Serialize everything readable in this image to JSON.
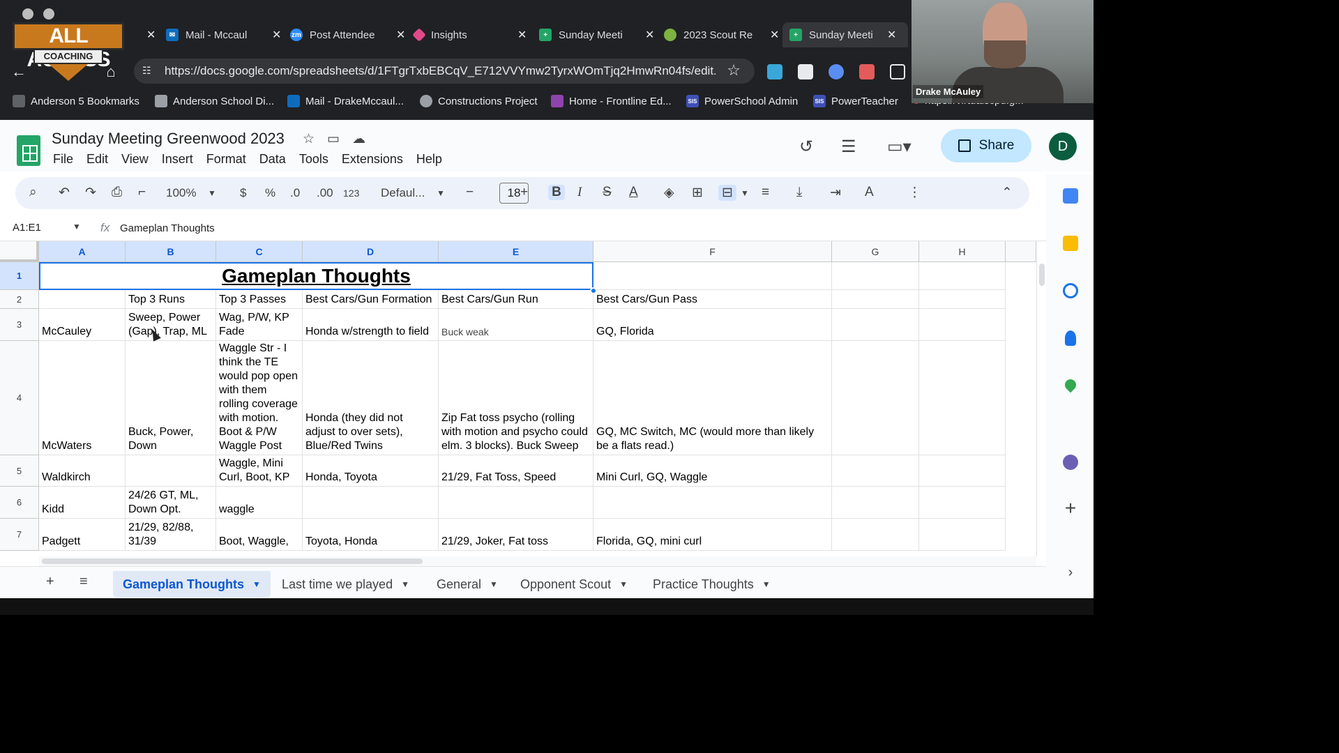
{
  "browser": {
    "tabs": [
      {
        "label": "",
        "kind": "logo"
      },
      {
        "label": "Mail - Mccaul",
        "icon_color": "#0f6cbd",
        "icon": "mail-icon"
      },
      {
        "label": "Post Attendee",
        "icon_color": "#2d8cff",
        "icon": "zoom-icon",
        "icon_text": "zm"
      },
      {
        "label": "Insights",
        "icon_color": "#e2498a",
        "icon": "insights-icon"
      },
      {
        "label": "Sunday Meeti",
        "icon_color": "#23a566",
        "icon": "sheets-icon"
      },
      {
        "label": "2023 Scout Re",
        "icon_color": "#7cb342",
        "icon": "drive-icon"
      },
      {
        "label": "Sunday Meeti",
        "icon_color": "#23a566",
        "icon": "sheets-icon",
        "active": true
      }
    ],
    "url": "https://docs.google.com/spreadsheets/d/1FTgrTxbEBCqV_E712VVYmw2TyrxWOmTjq2HmwRn04fs/edit...",
    "bookmarks": [
      {
        "label": "Anderson 5 Bookmarks",
        "icon": "folder-icon"
      },
      {
        "label": "Anderson School Di...",
        "icon": "school-icon"
      },
      {
        "label": "Mail - DrakeMccaul...",
        "icon": "mail-icon"
      },
      {
        "label": "Constructions Project",
        "icon": "globe-icon"
      },
      {
        "label": "Home - Frontline Ed...",
        "icon": "frontline-icon"
      },
      {
        "label": "PowerSchool Admin",
        "icon": "sis-icon",
        "icon_text": "SIS"
      },
      {
        "label": "PowerTeacher",
        "icon": "sis-icon",
        "icon_text": "SIS"
      },
      {
        "label": "https://virtualscpd.g...",
        "icon": "link-icon"
      }
    ],
    "logo": {
      "line1": "ALL ACCESS",
      "line2": "COACHING"
    }
  },
  "webcam": {
    "name": "Drake McAuley"
  },
  "doc": {
    "title": "Sunday Meeting Greenwood 2023",
    "menu": [
      "File",
      "Edit",
      "View",
      "Insert",
      "Format",
      "Data",
      "Tools",
      "Extensions",
      "Help"
    ],
    "share_label": "Share",
    "avatar_letter": "D"
  },
  "toolbar": {
    "zoom": "100%",
    "currency": "$",
    "percent": "%",
    "dec_decrease": ".0",
    "dec_increase": ".00",
    "number_format": "123",
    "font": "Defaul...",
    "font_size": "18"
  },
  "formula_bar": {
    "name_box": "A1:E1",
    "fx": "fx",
    "value": "Gameplan Thoughts"
  },
  "grid": {
    "columns": [
      "A",
      "B",
      "C",
      "D",
      "E",
      "F",
      "G",
      "H"
    ],
    "rows": [
      "1",
      "2",
      "3",
      "4",
      "5",
      "6",
      "7"
    ],
    "title": "Gameplan Thoughts",
    "row2": [
      "",
      "Top 3 Runs",
      "Top 3 Passes",
      "Best Cars/Gun Formation",
      "Best Cars/Gun Run",
      "Best Cars/Gun Pass"
    ],
    "row3": [
      "McCauley",
      "Sweep, Power (Gap), Trap, ML",
      "Wag, P/W, KP Fade",
      "Honda w/strength to field",
      "Buck weak",
      "GQ, Florida"
    ],
    "row4": [
      "McWaters",
      "Buck, Power, Down",
      "Waggle Str - I think the TE would pop open with them rolling coverage with motion. Boot & P/W Waggle Post",
      "Honda (they did not adjust to over sets), Blue/Red Twins",
      "Zip Fat toss psycho (rolling with motion and psycho could elm. 3 blocks). Buck Sweep",
      "GQ, MC Switch, MC (would more than likely be a flats read.)"
    ],
    "row5": [
      "Waldkirch",
      "",
      "Waggle, Mini Curl, Boot, KP",
      "Honda, Toyota",
      "21/29, Fat Toss, Speed",
      "Mini Curl, GQ, Waggle"
    ],
    "row6": [
      "Kidd",
      "24/26 GT, ML, Down Opt.",
      "waggle",
      "",
      "",
      ""
    ],
    "row7": [
      "Padgett",
      "21/29, 82/88, 31/39",
      "Boot, Waggle,",
      "Toyota, Honda",
      "21/29, Joker, Fat toss",
      "Florida, GQ, mini curl"
    ]
  },
  "sheet_tabs": [
    "Gameplan Thoughts",
    "Last time we played",
    "General",
    "Opponent Scout",
    "Practice Thoughts"
  ],
  "active_sheet": "Gameplan Thoughts"
}
